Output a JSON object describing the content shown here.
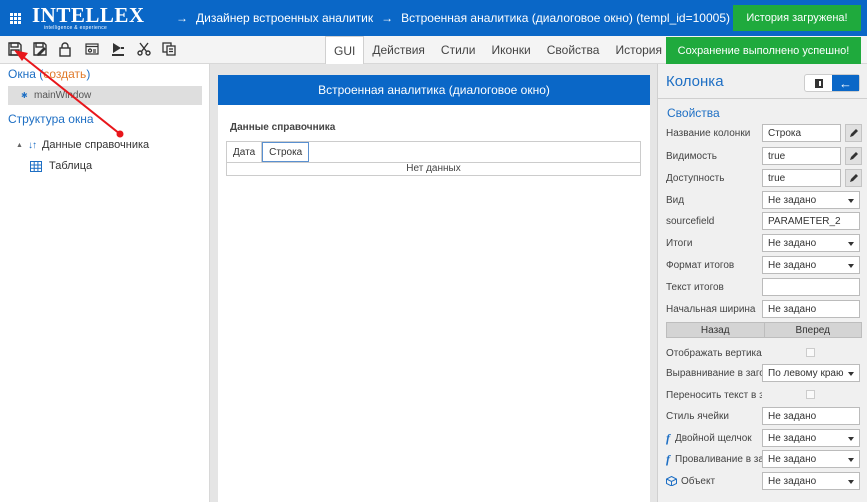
{
  "header": {
    "logo_main": "INTELLEX",
    "logo_sub": "intelligence & experience",
    "crumb_arrow": "→",
    "crumb1": "Дизайнер встроенных аналитик",
    "crumb2": "Встроенная аналитика (диалоговое окно) (templ_id=10005)",
    "brand_color": "#0a67c7"
  },
  "toasts": {
    "loaded": "История загружена!",
    "saved": "Сохранение выполнено успешно!",
    "color": "#1faa3d"
  },
  "toolbar": {
    "icons": [
      "save-icon",
      "save-as-icon",
      "lock-icon",
      "properties-icon",
      "deploy-icon",
      "cut-icon",
      "copy-icon"
    ]
  },
  "tabs": [
    {
      "label": "GUI",
      "active": true
    },
    {
      "label": "Действия",
      "active": false
    },
    {
      "label": "Стили",
      "active": false
    },
    {
      "label": "Иконки",
      "active": false
    },
    {
      "label": "Свойства",
      "active": false
    },
    {
      "label": "История",
      "active": false
    }
  ],
  "left": {
    "windows_label": "Окна",
    "windows_create_open": "(",
    "windows_create": "создать",
    "windows_create_close": ")",
    "main_window": "mainWindow",
    "structure_label": "Структура окна",
    "tree": [
      {
        "label": "Данные справочника"
      },
      {
        "label": "Таблица"
      }
    ]
  },
  "center": {
    "dialog_title": "Встроенная аналитика (диалоговое окно)",
    "dataset_title": "Данные справочника",
    "columns": [
      "Дата",
      "Строка"
    ],
    "empty_text": "Нет данных"
  },
  "right": {
    "title": "Колонка",
    "toggle_arrow": "←",
    "section": "Свойства",
    "props": [
      {
        "label": "Название колонки",
        "value": "Строка"
      },
      {
        "label": "Видимость",
        "value": "true"
      },
      {
        "label": "Доступность",
        "value": "true"
      },
      {
        "label": "Вид",
        "value": "Не задано"
      },
      {
        "label": "sourcefield",
        "value": "PARAMETER_2"
      },
      {
        "label": "Итоги",
        "value": "Не задано"
      },
      {
        "label": "Формат итогов",
        "value": "Не задано"
      },
      {
        "label": "Текст итогов",
        "value": ""
      },
      {
        "label": "Начальная ширина",
        "value": "Не задано"
      }
    ],
    "nav_back": "Назад",
    "nav_forward": "Вперед",
    "props2": [
      {
        "label": "Отображать вертикальные линии"
      },
      {
        "label": "Выравнивание в заголовке",
        "value": "По левому краю"
      },
      {
        "label": "Переносить текст в заголовке"
      },
      {
        "label": "Стиль ячейки",
        "value": "Не задано"
      },
      {
        "label": "Двойной щелчок",
        "value": "Не задано"
      },
      {
        "label": "Проваливание в запись",
        "value": "Не задано"
      },
      {
        "label": "Объект",
        "value": "Не задано"
      }
    ],
    "fx_glyph": "f"
  }
}
